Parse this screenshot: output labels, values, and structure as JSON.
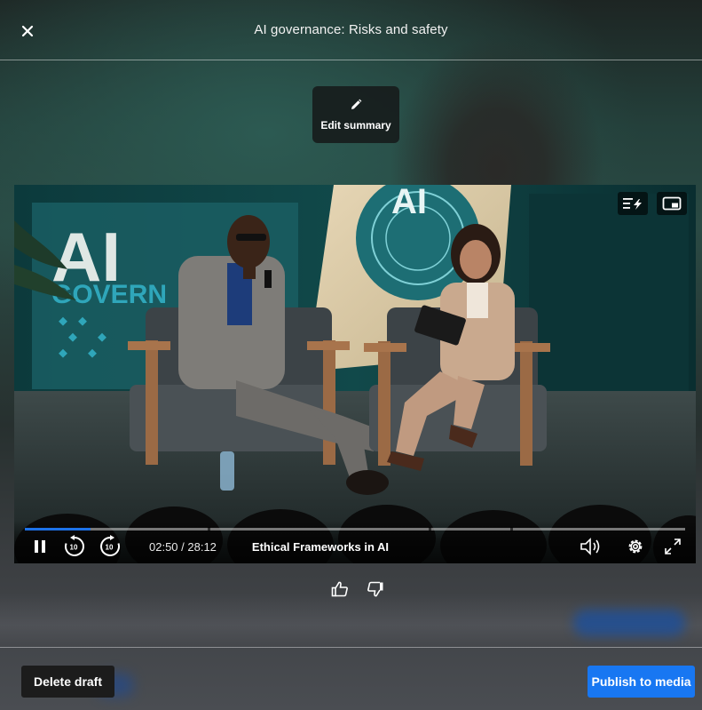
{
  "header": {
    "title": "AI governance: Risks and safety",
    "close_icon": "close-icon"
  },
  "edit_summary": {
    "label": "Edit summary",
    "icon": "pencil-icon"
  },
  "video": {
    "backdrop_text_1": "AI",
    "backdrop_text_2": "GOVERN",
    "screen_text": "AI",
    "current_time": "02:50",
    "duration": "28:12",
    "time_display": "02:50 / 28:12",
    "progress_fraction": 0.1,
    "chapter_title": "Ethical Frameworks in AI",
    "skip_back_seconds": "10",
    "skip_forward_seconds": "10",
    "top_icons": [
      "chapters-flash-icon",
      "picture-in-picture-icon"
    ],
    "control_icons": [
      "pause-icon",
      "rewind-10-icon",
      "forward-10-icon",
      "volume-icon",
      "settings-gear-icon",
      "fullscreen-icon"
    ]
  },
  "feedback": {
    "icons": [
      "thumbs-up-icon",
      "thumbs-down-icon"
    ]
  },
  "footer": {
    "delete_label": "Delete draft",
    "publish_label": "Publish to media"
  },
  "colors": {
    "accent": "#1877f2",
    "progress": "#1d72e8",
    "delete_bg": "#1c1c1c"
  }
}
